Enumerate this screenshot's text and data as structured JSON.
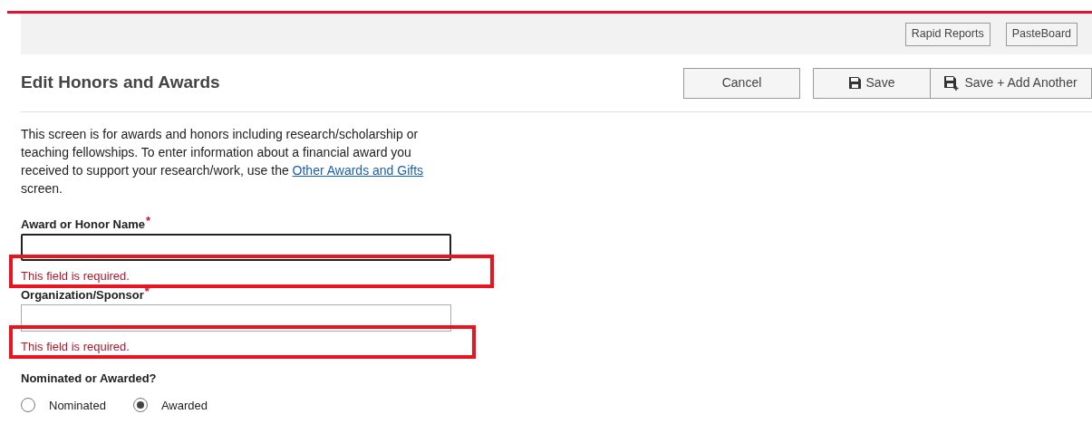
{
  "top_bar": {
    "buttons": [
      "Rapid Reports",
      "PasteBoard"
    ]
  },
  "header": {
    "title": "Edit Honors and Awards",
    "buttons": [
      {
        "label": "Cancel",
        "kind": "plain"
      },
      {
        "label": "Save",
        "kind": "save"
      },
      {
        "label": "Save + Add Another",
        "kind": "save_add"
      }
    ]
  },
  "intro": {
    "text": "This screen is for awards and honors including research/scholarship or teaching fellowships. To enter information about a financial award you received to support your research/work, use the",
    "link": "Other Awards and Gifts",
    "after": "screen."
  },
  "fields": [
    {
      "label": "Award or Honor Name",
      "required_mark": "*",
      "focused": true,
      "error": "This field is required.",
      "highlighted": true
    },
    {
      "label": "Organization/Sponsor",
      "required_mark": "*",
      "focused": false,
      "error": "This field is required.",
      "highlighted": true
    }
  ],
  "nominated": {
    "label": "Nominated or Awarded?",
    "options": [
      {
        "label": "Nominated",
        "selected": false
      },
      {
        "label": "Awarded",
        "selected": true
      }
    ]
  }
}
